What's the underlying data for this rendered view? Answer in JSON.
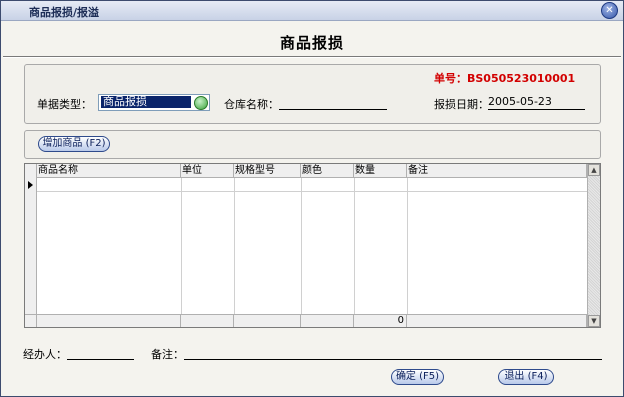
{
  "window": {
    "title": "商品报损/报溢"
  },
  "form": {
    "heading": "商品报损",
    "doc_no": "单号：BS050523010001",
    "type_label": "单据类型：",
    "type_value": "商品报损",
    "warehouse_label": "仓库名称：",
    "warehouse_value": "",
    "date_label": "报损日期：",
    "date_value": "2005-05-23"
  },
  "toolbar": {
    "add_label": "增加商品 (F2)"
  },
  "table": {
    "columns": [
      "商品名称",
      "单位",
      "规格型号",
      "颜色",
      "数量",
      "备注"
    ],
    "rows": [],
    "total_quantity": "0"
  },
  "bottom": {
    "handler_label": "经办人：",
    "handler_value": "",
    "remark_label": "备注：",
    "remark_value": "",
    "ok_label": "确定 (F5)",
    "exit_label": "退出 (F4)"
  },
  "colors": {
    "doc_no": "#d20000",
    "accent": "#3556a8"
  }
}
